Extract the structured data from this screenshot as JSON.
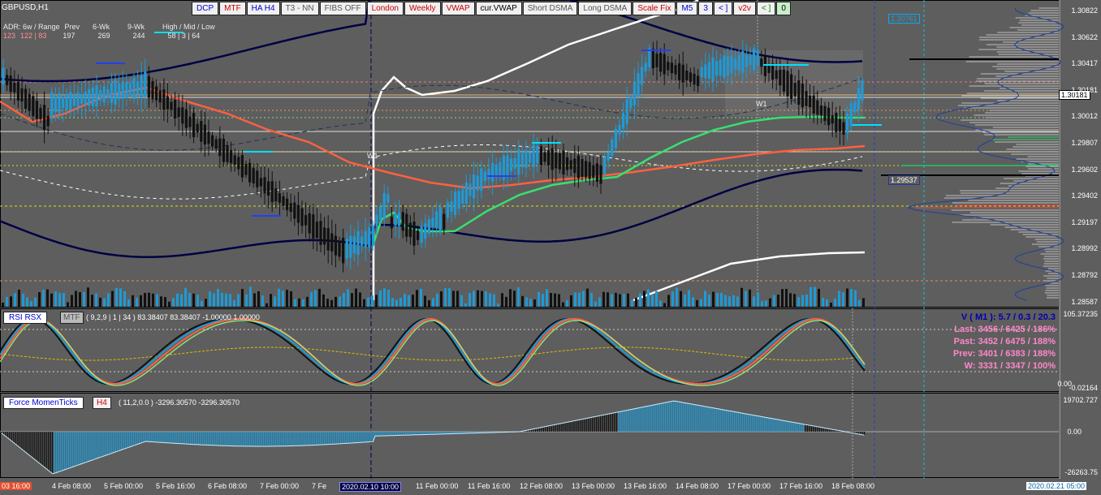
{
  "symbol": "GBPUSD,H1",
  "toolbar": [
    {
      "label": "DCP",
      "color": "#0000cc",
      "bg": "#f0f0f0"
    },
    {
      "label": "MTF",
      "color": "#cc0000",
      "bg": "#f0f0f0"
    },
    {
      "label": "HA H4",
      "color": "#0000cc",
      "bg": "#f0f0f0"
    },
    {
      "label": "T3 - NN",
      "color": "#555555",
      "bg": "#f0f0f0"
    },
    {
      "label": "FIBS OFF",
      "color": "#555555",
      "bg": "#f0f0f0"
    },
    {
      "label": "London",
      "color": "#cc0000",
      "bg": "#f0f0f0"
    },
    {
      "label": "Weekly",
      "color": "#cc0000",
      "bg": "#f0f0f0"
    },
    {
      "label": "VWAP",
      "color": "#cc0000",
      "bg": "#f0f0f0"
    },
    {
      "label": "cur.VWAP",
      "color": "#000000",
      "bg": "#f0f0f0"
    },
    {
      "label": "Short DSMA",
      "color": "#555555",
      "bg": "#f0f0f0"
    },
    {
      "label": "Long DSMA",
      "color": "#555555",
      "bg": "#f0f0f0"
    },
    {
      "label": "Scale Fix",
      "color": "#cc0000",
      "bg": "#f0f0f0"
    },
    {
      "label": "M5",
      "color": "#0000cc",
      "bg": "#f0f0f0"
    },
    {
      "label": "3",
      "color": "#0000cc",
      "bg": "#f0f0f0"
    },
    {
      "label": "< ]",
      "color": "#0000cc",
      "bg": "#f0f0f0"
    },
    {
      "label": "v2v",
      "color": "#cc0000",
      "bg": "#f0f0f0"
    },
    {
      "label": "< ]",
      "color": "#008800",
      "bg": "#f0f0f0"
    },
    {
      "label": "0",
      "color": "#000000",
      "bg": "#c8f0c8"
    }
  ],
  "stats": {
    "header": [
      "ADR: 6w / Range",
      "Prev",
      "6-Wk",
      "9-Wk",
      "High / Mid / Low"
    ],
    "values": [
      "123",
      "122 | 83",
      "197",
      "269",
      "244",
      "58 | 3 | 64"
    ]
  },
  "price_axis": [
    "1.30822",
    "1.30622",
    "1.30417",
    "1.30181",
    "1.30012",
    "1.29807",
    "1.29602",
    "1.29402",
    "1.29197",
    "1.28992",
    "1.28792",
    "1.28587"
  ],
  "price_box_top": "1.30761",
  "price_box_current": "1.30181",
  "price_box_low": "1.29537",
  "time_axis": [
    "4 Feb 08:00",
    "5 Feb 00:00",
    "5 Feb 16:00",
    "6 Feb 08:00",
    "7 Feb 00:00",
    "7 Fe",
    "11 Feb 00:00",
    "11 Feb 16:00",
    "12 Feb 08:00",
    "13 Feb 00:00",
    "13 Feb 16:00",
    "14 Feb 08:00",
    "17 Feb 00:00",
    "17 Feb 16:00",
    "18 Feb 08:00"
  ],
  "time_left": "03 16:00",
  "time_cursor": "2020.02.10 10:00",
  "time_right": "2020.02.21 05:00",
  "rsi": {
    "label": "RSI RSX",
    "mtf": "MTF",
    "params": "( 9,2,9 | 1 | 34 ) 83.38407 83.38407 -1.00000 1.00000",
    "axis_top": "105.37235",
    "axis_bottom": "-0.02164",
    "axis_mid": "0.00"
  },
  "vinfo": {
    "v": "V ( M1 ): 5.7 / 0.3 / 20.3",
    "last": "Last: 3456 / 6425 / 186%",
    "past": "Past: 3452 / 6475 / 188%",
    "prev": "Prev: 3401 / 6383 / 188%",
    "w": "W: 3331 / 3347 / 100%"
  },
  "force": {
    "label": "Force MomenTicks",
    "tf": "H4",
    "params": "( 11,2,0.0 ) -3296.30570 -3296.30570",
    "axis_top": "19702.727",
    "axis_mid": "0.00",
    "axis_bottom": "-26263.75"
  },
  "week_labels": [
    "W1",
    "W1"
  ],
  "colors": {
    "bg": "#5e5e5e",
    "blue": "#1e9ad6",
    "green": "#38e070",
    "orange": "#ff6040"
  }
}
